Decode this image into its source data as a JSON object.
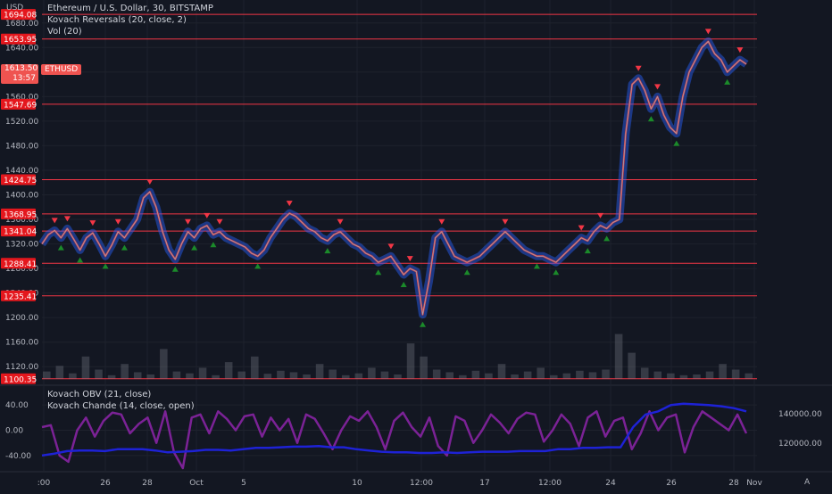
{
  "currency": "USD",
  "legend": {
    "symbol_line": "Ethereum / U.S. Dollar, 30, BITSTAMP",
    "indicator1": "Kovach Reversals (20, close, 2)",
    "indicator2": "Vol (20)",
    "lower1": "Kovach OBV (21, close)",
    "lower2": "Kovach Chande (14, close, open)"
  },
  "price_badge": {
    "price": "1613.50",
    "symbol": "ETHUSD",
    "countdown": "13:57"
  },
  "corner_right": "A",
  "chart_data": {
    "type": "line",
    "title": "Ethereum / U.S. Dollar, 30, BITSTAMP",
    "y_ticks": [
      "1680.00",
      "1640.00",
      "1600.00",
      "1560.00",
      "1520.00",
      "1480.00",
      "1440.00",
      "1400.00",
      "1360.00",
      "1320.00",
      "1280.00",
      "1240.00",
      "1200.00",
      "1160.00",
      "1120.00"
    ],
    "ylim": [
      1100,
      1700
    ],
    "x_ticks": [
      ":00",
      "26",
      "28",
      "Oct",
      "5",
      "10",
      "12:00",
      "17",
      "12:00",
      "24",
      "26",
      "28",
      "Nov"
    ],
    "horizontal_levels": [
      "1694.08",
      "1653.95",
      "1547.69",
      "1424.75",
      "1368.95",
      "1341.04",
      "1288.41",
      "1235.41",
      "1100.35"
    ],
    "price_series": [
      1320,
      1335,
      1342,
      1330,
      1345,
      1328,
      1310,
      1330,
      1338,
      1320,
      1300,
      1318,
      1340,
      1330,
      1345,
      1360,
      1395,
      1405,
      1380,
      1340,
      1310,
      1295,
      1320,
      1340,
      1330,
      1345,
      1350,
      1335,
      1340,
      1330,
      1325,
      1320,
      1315,
      1305,
      1300,
      1310,
      1330,
      1345,
      1360,
      1370,
      1365,
      1355,
      1345,
      1340,
      1330,
      1325,
      1335,
      1340,
      1330,
      1320,
      1315,
      1305,
      1300,
      1290,
      1295,
      1300,
      1285,
      1270,
      1280,
      1275,
      1205,
      1260,
      1330,
      1340,
      1320,
      1300,
      1295,
      1290,
      1295,
      1300,
      1310,
      1320,
      1330,
      1340,
      1330,
      1320,
      1310,
      1305,
      1300,
      1300,
      1295,
      1290,
      1300,
      1310,
      1320,
      1330,
      1325,
      1340,
      1350,
      1345,
      1355,
      1360,
      1500,
      1580,
      1590,
      1570,
      1540,
      1560,
      1530,
      1510,
      1500,
      1560,
      1600,
      1620,
      1640,
      1650,
      1630,
      1620,
      1600,
      1610,
      1620,
      1613
    ],
    "oscillator_series": [
      5,
      8,
      -40,
      -50,
      0,
      20,
      -10,
      15,
      28,
      25,
      -5,
      10,
      20,
      -20,
      30,
      -35,
      -60,
      20,
      25,
      -5,
      30,
      18,
      0,
      22,
      25,
      -10,
      20,
      0,
      18,
      -20,
      25,
      18,
      -5,
      -30,
      0,
      22,
      15,
      30,
      5,
      -30,
      15,
      28,
      5,
      -10,
      20,
      -25,
      -40,
      22,
      15,
      -20,
      0,
      25,
      12,
      -5,
      18,
      28,
      25,
      -18,
      0,
      25,
      10,
      -25,
      20,
      30,
      -10,
      15,
      20,
      -30,
      -5,
      30,
      0,
      20,
      25,
      -35,
      5,
      30,
      20,
      10,
      0,
      25,
      -5
    ],
    "obv_series": [
      -40,
      -37,
      -33,
      -32,
      -32,
      -33,
      -30,
      -30,
      -30,
      -32,
      -35,
      -34,
      -33,
      -31,
      -31,
      -32,
      -30,
      -28,
      -28,
      -27,
      -26,
      -26,
      -25,
      -27,
      -27,
      -30,
      -32,
      -34,
      -35,
      -35,
      -36,
      -36,
      -35,
      -36,
      -35,
      -34,
      -34,
      -34,
      -33,
      -33,
      -33,
      -30,
      -30,
      -28,
      -28,
      -27,
      -27,
      5,
      25,
      30,
      40,
      42,
      41,
      40,
      38,
      35,
      30
    ],
    "lower_y_ticks_left": [
      "40.00",
      "0.00",
      "-40.00"
    ],
    "lower_y_ticks_right": [
      "140000.00",
      "120000.00"
    ],
    "volume_series": [
      20,
      35,
      15,
      60,
      25,
      10,
      40,
      18,
      12,
      80,
      20,
      15,
      30,
      10,
      45,
      20,
      60,
      14,
      22,
      18,
      12,
      40,
      25,
      10,
      15,
      30,
      20,
      12,
      95,
      60,
      25,
      18,
      10,
      22,
      15,
      40,
      12,
      20,
      30,
      10,
      15,
      22,
      18,
      25,
      120,
      70,
      30,
      20,
      15,
      10,
      12,
      20,
      40,
      25,
      15
    ]
  }
}
